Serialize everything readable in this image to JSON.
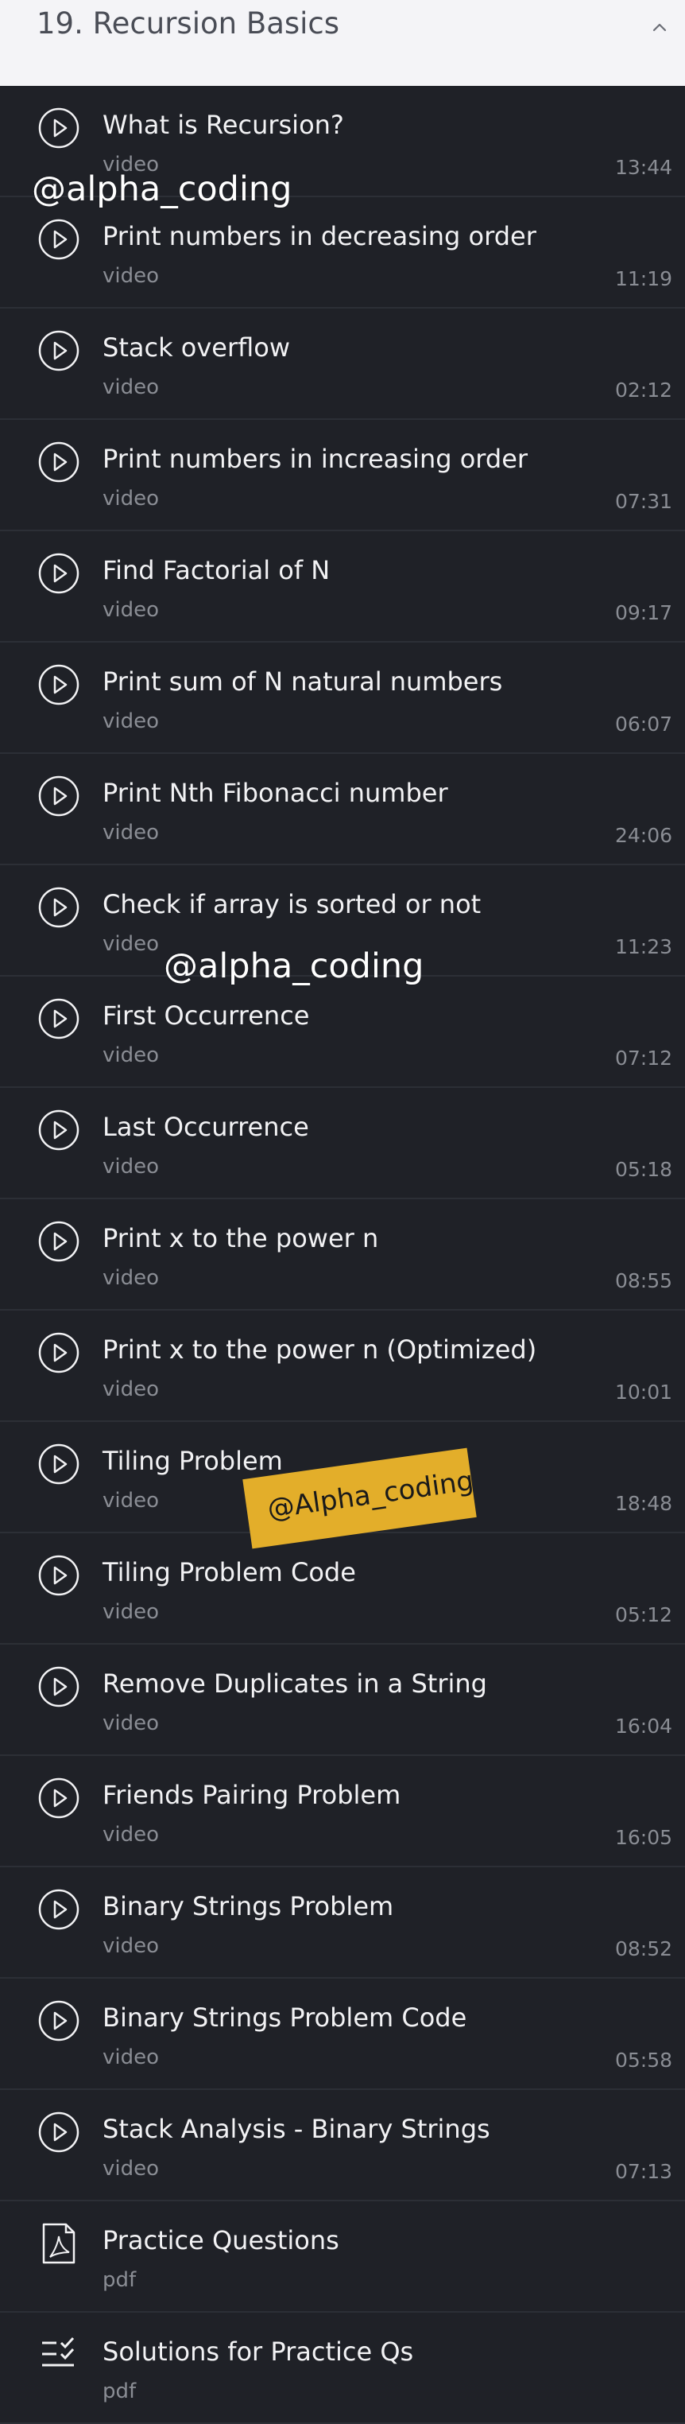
{
  "section": {
    "title": "19. Recursion Basics",
    "collapse_icon": "chevron-up-icon"
  },
  "items": [
    {
      "title": "What is Recursion?",
      "type": "video",
      "duration": "13:44",
      "icon": "play-circle-icon"
    },
    {
      "title": "Print numbers in decreasing order",
      "type": "video",
      "duration": "11:19",
      "icon": "play-circle-icon"
    },
    {
      "title": "Stack overflow",
      "type": "video",
      "duration": "02:12",
      "icon": "play-circle-icon"
    },
    {
      "title": "Print numbers in increasing order",
      "type": "video",
      "duration": "07:31",
      "icon": "play-circle-icon"
    },
    {
      "title": "Find Factorial of N",
      "type": "video",
      "duration": "09:17",
      "icon": "play-circle-icon"
    },
    {
      "title": "Print sum of N natural numbers",
      "type": "video",
      "duration": "06:07",
      "icon": "play-circle-icon"
    },
    {
      "title": "Print Nth Fibonacci number",
      "type": "video",
      "duration": "24:06",
      "icon": "play-circle-icon"
    },
    {
      "title": "Check if array is sorted or not",
      "type": "video",
      "duration": "11:23",
      "icon": "play-circle-icon"
    },
    {
      "title": "First Occurrence",
      "type": "video",
      "duration": "07:12",
      "icon": "play-circle-icon"
    },
    {
      "title": "Last Occurrence",
      "type": "video",
      "duration": "05:18",
      "icon": "play-circle-icon"
    },
    {
      "title": "Print x to the power n",
      "type": "video",
      "duration": "08:55",
      "icon": "play-circle-icon"
    },
    {
      "title": "Print x to the power n (Optimized)",
      "type": "video",
      "duration": "10:01",
      "icon": "play-circle-icon"
    },
    {
      "title": "Tiling Problem",
      "type": "video",
      "duration": "18:48",
      "icon": "play-circle-icon"
    },
    {
      "title": "Tiling Problem Code",
      "type": "video",
      "duration": "05:12",
      "icon": "play-circle-icon"
    },
    {
      "title": "Remove Duplicates in a String",
      "type": "video",
      "duration": "16:04",
      "icon": "play-circle-icon"
    },
    {
      "title": "Friends Pairing Problem",
      "type": "video",
      "duration": "16:05",
      "icon": "play-circle-icon"
    },
    {
      "title": "Binary Strings Problem",
      "type": "video",
      "duration": "08:52",
      "icon": "play-circle-icon"
    },
    {
      "title": "Binary Strings Problem Code",
      "type": "video",
      "duration": "05:58",
      "icon": "play-circle-icon"
    },
    {
      "title": "Stack Analysis - Binary Strings",
      "type": "video",
      "duration": "07:13",
      "icon": "play-circle-icon"
    },
    {
      "title": "Practice Questions",
      "type": "pdf",
      "duration": "",
      "icon": "pdf-file-icon"
    },
    {
      "title": "Solutions for Practice Qs",
      "type": "pdf",
      "duration": "",
      "icon": "checklist-icon"
    }
  ],
  "watermarks": [
    "@alpha_coding",
    "@alpha_coding",
    "@Alpha_coding"
  ],
  "colors": {
    "header_bg": "#f4f4f7",
    "list_bg": "#1f2127",
    "divider": "#2c2f36",
    "title_text": "#f2f2f4",
    "muted_text": "#8a8d94",
    "sticker_bg": "#e3ae2a"
  }
}
